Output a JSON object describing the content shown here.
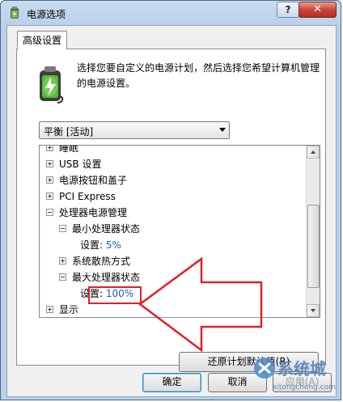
{
  "window": {
    "title": "电源选项",
    "help": "?",
    "close": "✕"
  },
  "tab": {
    "label": "高级设置"
  },
  "description": "选择您要自定义的电源计划，然后选择您希望计算机管理的电源设置。",
  "plan_select": {
    "value": "平衡 [活动]"
  },
  "tree": {
    "items": [
      {
        "label": "睡眠",
        "level": 0,
        "state": "collapsed"
      },
      {
        "label": "USB 设置",
        "level": 0,
        "state": "collapsed"
      },
      {
        "label": "电源按钮和盖子",
        "level": 0,
        "state": "collapsed"
      },
      {
        "label": "PCI Express",
        "level": 0,
        "state": "collapsed"
      },
      {
        "label": "处理器电源管理",
        "level": 0,
        "state": "expanded"
      },
      {
        "label": "最小处理器状态",
        "level": 1,
        "state": "expanded"
      },
      {
        "label": "设置: ",
        "value": "5%",
        "level": 2,
        "state": "leaf"
      },
      {
        "label": "系统散热方式",
        "level": 1,
        "state": "collapsed"
      },
      {
        "label": "最大处理器状态",
        "level": 1,
        "state": "expanded"
      },
      {
        "label": "设置: ",
        "value": "100%",
        "level": 2,
        "state": "leaf"
      },
      {
        "label": "显示",
        "level": 0,
        "state": "collapsed"
      }
    ]
  },
  "buttons": {
    "restore": "还原计划默认值(R)",
    "ok": "确定",
    "cancel": "取消",
    "apply": "应用(A)"
  },
  "watermark": {
    "text1": "系统城",
    "text2": "xitongcheng.com"
  },
  "colors": {
    "annotation": "#e0202a",
    "link": "#1a5fb4"
  }
}
